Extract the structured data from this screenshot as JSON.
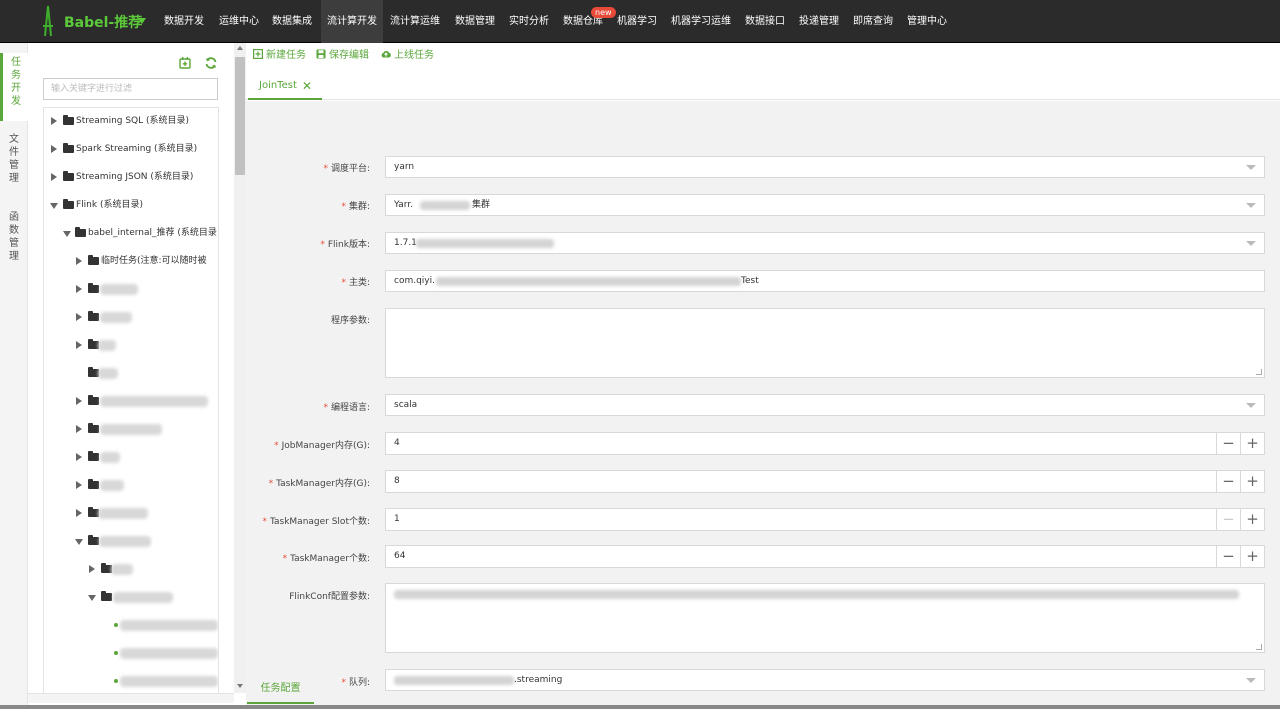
{
  "brand": {
    "name": "Babel-推荐"
  },
  "nav": {
    "items": [
      "数据开发",
      "运维中心",
      "数据集成",
      "流计算开发",
      "流计算运维",
      "数据管理",
      "实时分析",
      "数据仓库",
      "机器学习",
      "机器学习运维",
      "数据接口",
      "投递管理",
      "即席查询",
      "管理中心"
    ],
    "active": "流计算开发",
    "badge": "new"
  },
  "vtabs": [
    {
      "chars": [
        "任",
        "务",
        "开",
        "发"
      ],
      "active": true
    },
    {
      "chars": [
        "文",
        "件",
        "管",
        "理"
      ],
      "active": false
    },
    {
      "chars": [
        "函",
        "数",
        "管",
        "理"
      ],
      "active": false
    }
  ],
  "tree": {
    "search_placeholder": "输入关键字进行过滤",
    "nodes": [
      {
        "label": "Streaming SQL (系统目录)"
      },
      {
        "label": "Spark Streaming (系统目录)"
      },
      {
        "label": "Streaming JSON (系统目录)"
      },
      {
        "label": "Flink (系统目录)"
      },
      {
        "label": "babel_internal_推荐 (系统目录"
      },
      {
        "label": "临时任务(注意:可以随时被"
      }
    ]
  },
  "toolbar": {
    "new_task": "新建任务",
    "save_edit": "保存编辑",
    "publish": "上线任务"
  },
  "tab": {
    "label": "JoinTest"
  },
  "form": {
    "platform": {
      "label": "调度平台:",
      "value": "yarn"
    },
    "cluster": {
      "label": "集群:",
      "value_prefix": "Yarr.",
      "value_suffix": "集群"
    },
    "flink_version": {
      "label": "Flink版本:",
      "value": "1.7.1"
    },
    "main_class": {
      "label": "主类:",
      "value_prefix": "com.qiyi.",
      "value_suffix": "Test"
    },
    "program_args": {
      "label": "程序参数:",
      "value": ""
    },
    "language": {
      "label": "编程语言:",
      "value": "scala"
    },
    "jm_memory": {
      "label": "JobManager内存(G):",
      "value": "4"
    },
    "tm_memory": {
      "label": "TaskManager内存(G):",
      "value": "8"
    },
    "tm_slots": {
      "label": "TaskManager Slot个数:",
      "value": "1"
    },
    "tm_count": {
      "label": "TaskManager个数:",
      "value": "64"
    },
    "flink_conf": {
      "label": "FlinkConf配置参数:"
    },
    "queue": {
      "label": "队列:",
      "value_suffix": ".streaming"
    }
  },
  "bottom_tab": {
    "label": "任务配置"
  },
  "colors": {
    "accent": "#5aa63a",
    "brand": "#5cc93a",
    "nav_bg": "#2b2b2b",
    "required": "#e84a3a"
  }
}
